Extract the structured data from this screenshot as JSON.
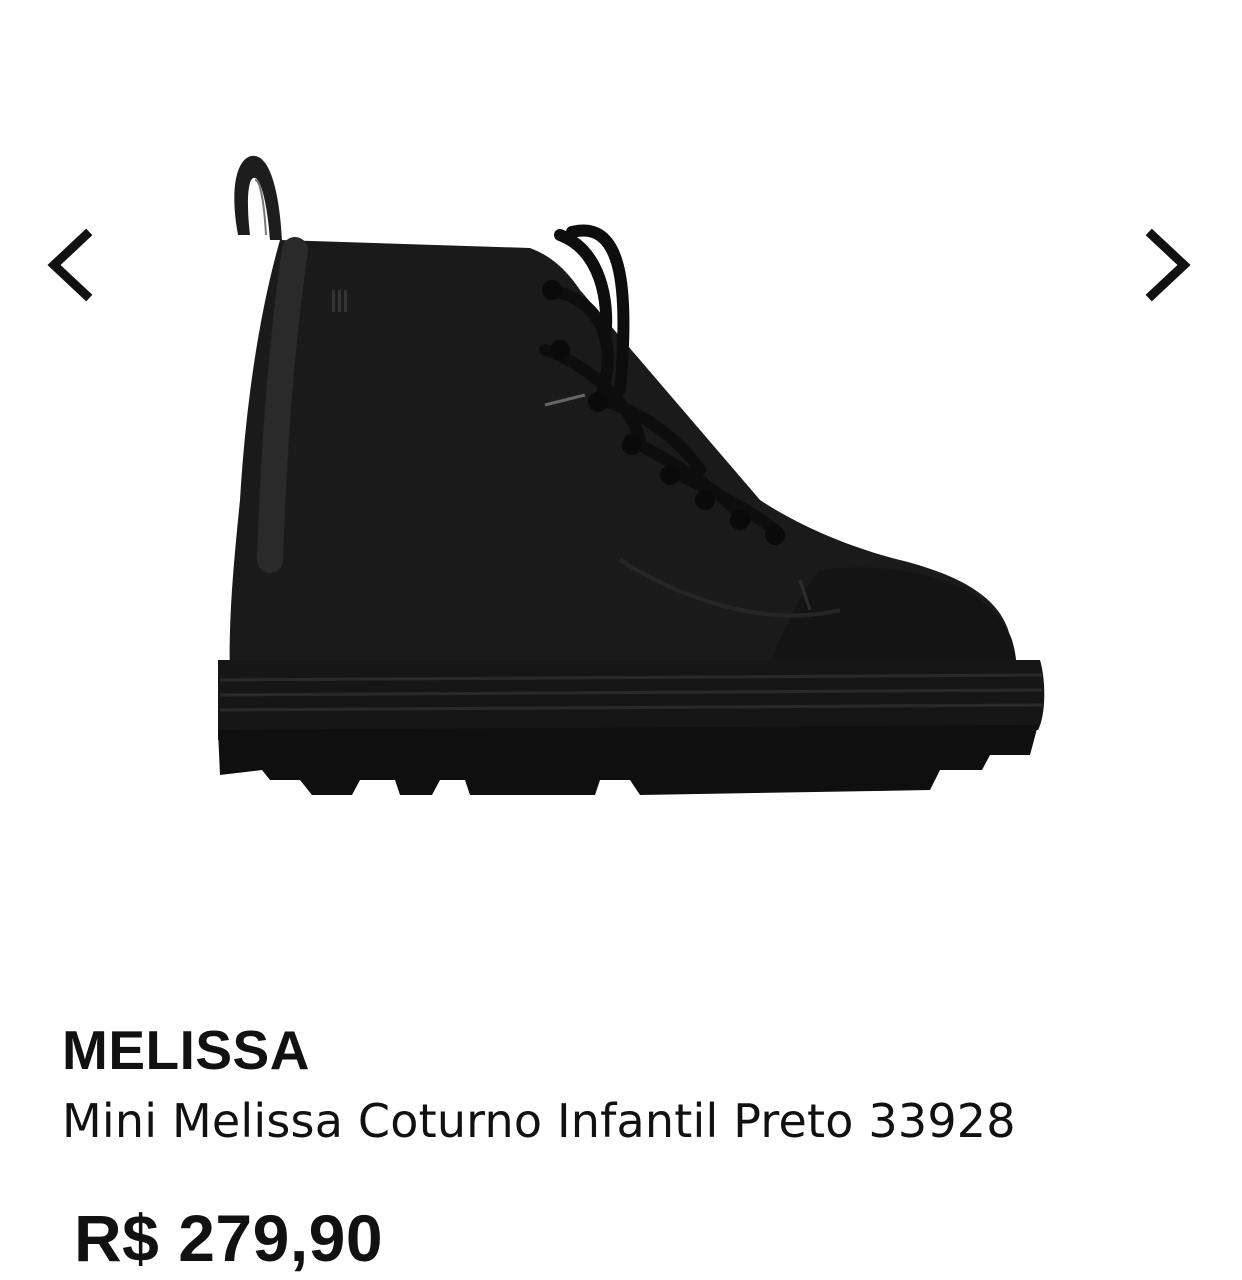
{
  "gallery": {
    "prev_icon": "chevron-left-icon",
    "next_icon": "chevron-right-icon",
    "image_subject": "black-lace-up-boot"
  },
  "product": {
    "brand": "MELISSA",
    "name": "Mini Melissa Coturno Infantil Preto 33928",
    "price": "R$ 279,90"
  },
  "colors": {
    "text": "#111111",
    "background": "#ffffff",
    "boot": "#1a1a1a"
  }
}
